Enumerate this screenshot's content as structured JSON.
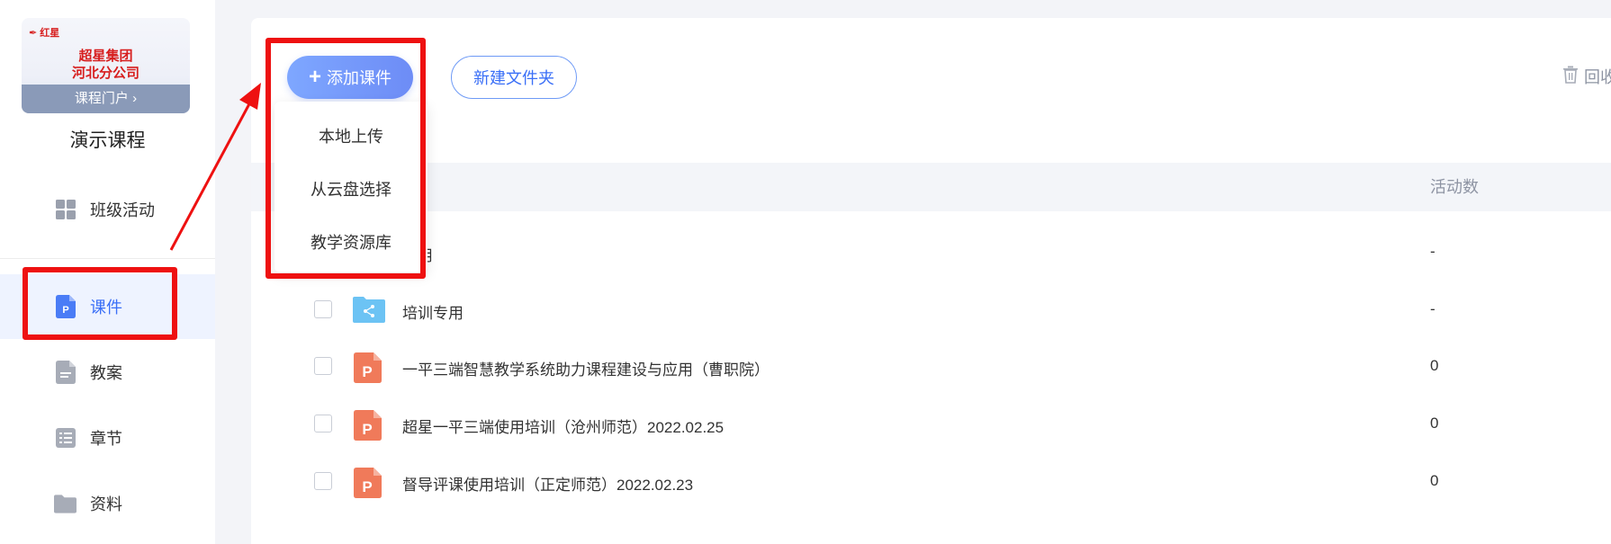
{
  "sidebar": {
    "logo": {
      "mark": "✒ 红星",
      "line1": "超星集团",
      "line2": "河北分公司",
      "portal": "课程门户 ›"
    },
    "course_title": "演示课程",
    "items": [
      {
        "label": "班级活动",
        "icon": "grid-icon"
      },
      {
        "label": "课件",
        "icon": "ppt-file-icon",
        "active": true
      },
      {
        "label": "教案",
        "icon": "lesson-plan-icon"
      },
      {
        "label": "章节",
        "icon": "list-icon"
      },
      {
        "label": "资料",
        "icon": "folder-icon"
      }
    ]
  },
  "toolbar": {
    "add_label": "添加课件",
    "new_folder_label": "新建文件夹",
    "recycle_label": "回收"
  },
  "dropdown": {
    "items": [
      "本地上传",
      "从云盘选择",
      "教学资源库"
    ]
  },
  "table": {
    "activity_header": "活动数",
    "rows": [
      {
        "name": "自用",
        "activity": "-",
        "icon": "shared-folder-icon"
      },
      {
        "name": "培训专用",
        "activity": "-",
        "icon": "shared-folder-icon"
      },
      {
        "name": "一平三端智慧教学系统助力课程建设与应用（曹职院）",
        "activity": "0",
        "icon": "ppt-file-icon"
      },
      {
        "name": "超星一平三端使用培训（沧州师范）2022.02.25",
        "activity": "0",
        "icon": "ppt-file-icon"
      },
      {
        "name": "督导评课使用培训（正定师范）2022.02.23",
        "activity": "0",
        "icon": "ppt-file-icon"
      }
    ]
  },
  "colors": {
    "accent": "#3a6ff7",
    "annotation": "#ee1111",
    "ppt": "#f07a5a",
    "folder": "#6cc3f4"
  }
}
